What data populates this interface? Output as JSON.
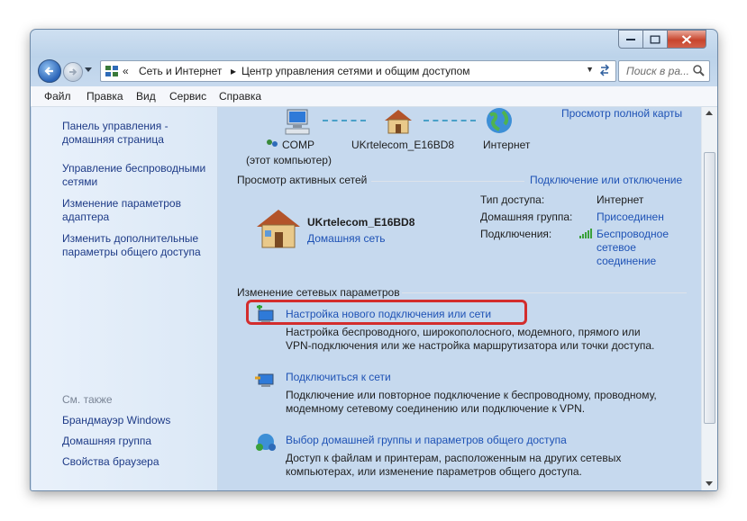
{
  "breadcrumb": {
    "chevrons": "«",
    "part1": "Сеть и Интернет",
    "part2": "Центр управления сетями и общим доступом"
  },
  "search": {
    "placeholder": "Поиск в ра..."
  },
  "menu": [
    "Файл",
    "Правка",
    "Вид",
    "Сервис",
    "Справка"
  ],
  "left_pane": {
    "links": [
      "Панель управления - домашняя страница",
      "Управление беспроводными сетями",
      "Изменение параметров адаптера",
      "Изменить дополнительные параметры общего доступа"
    ],
    "see_also_label": "См. также",
    "see_also": [
      "Брандмауэр Windows",
      "Домашняя группа",
      "Свойства браузера"
    ]
  },
  "map": {
    "full_map_link": "Просмотр полной карты",
    "computer_name": "COMP",
    "computer_sub": "(этот компьютер)",
    "router_name": "UKrtelecom_E16BD8",
    "internet_name": "Интернет"
  },
  "active": {
    "heading": "Просмотр активных сетей",
    "connect_link": "Подключение или отключение",
    "network_name": "UKrtelecom_E16BD8",
    "network_type": "Домашняя сеть",
    "access_label": "Тип доступа:",
    "access_value": "Интернет",
    "homegroup_label": "Домашняя группа:",
    "homegroup_value": "Присоединен",
    "connections_label": "Подключения:",
    "connections_value": "Беспроводное сетевое соединение"
  },
  "change": {
    "heading": "Изменение сетевых параметров",
    "items": [
      {
        "title": "Настройка нового подключения или сети",
        "desc1": "Настройка беспроводного, широкополосного, модемного, прямого или",
        "desc2": "VPN-подключения или же настройка маршрутизатора или точки доступа."
      },
      {
        "title": "Подключиться к сети",
        "desc1": "Подключение или повторное подключение к беспроводному, проводному,",
        "desc2": "модемному сетевому соединению или подключение к VPN."
      },
      {
        "title": "Выбор домашней группы и параметров общего доступа",
        "desc1": "Доступ к файлам и принтерам, расположенным на других сетевых",
        "desc2": "компьютерах, или изменение параметров общего доступа."
      }
    ]
  },
  "colors": {
    "link": "#1e52b5",
    "highlight": "#d32d2d",
    "titlebar": "#c6d9ee"
  }
}
